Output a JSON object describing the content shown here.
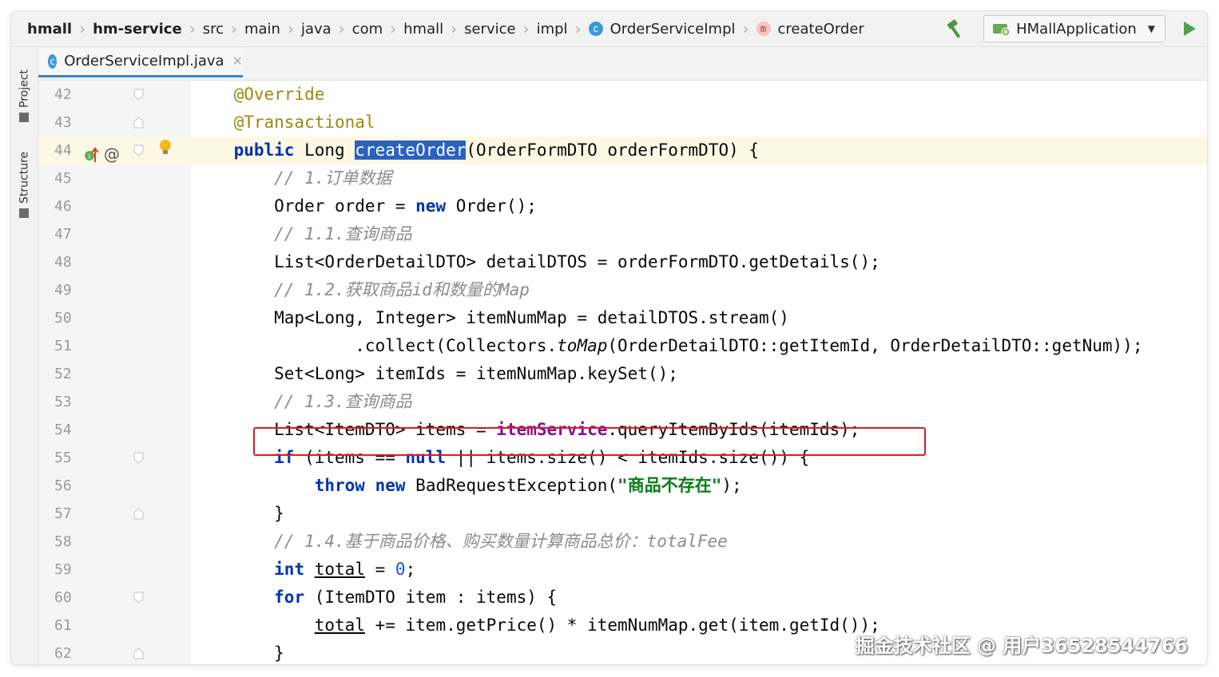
{
  "breadcrumbs": [
    {
      "label": "hmall",
      "bold": true,
      "icon": ""
    },
    {
      "label": "hm-service",
      "bold": true,
      "icon": ""
    },
    {
      "label": "src",
      "bold": false,
      "icon": ""
    },
    {
      "label": "main",
      "bold": false,
      "icon": ""
    },
    {
      "label": "java",
      "bold": false,
      "icon": ""
    },
    {
      "label": "com",
      "bold": false,
      "icon": ""
    },
    {
      "label": "hmall",
      "bold": false,
      "icon": ""
    },
    {
      "label": "service",
      "bold": false,
      "icon": ""
    },
    {
      "label": "impl",
      "bold": false,
      "icon": ""
    },
    {
      "label": "OrderServiceImpl",
      "bold": false,
      "icon": "class-icon",
      "icon_letter": "c"
    },
    {
      "label": "createOrder",
      "bold": false,
      "icon": "method-icon",
      "icon_letter": "m"
    }
  ],
  "toolbar": {
    "build_icon": "hammer-icon",
    "run_config_label": "HMallApplication",
    "run_icon": "run-icon"
  },
  "left_tools": {
    "project_label": "Project",
    "structure_label": "Structure"
  },
  "tabs": [
    {
      "label": "OrderServiceImpl.java",
      "icon_letter": "c",
      "active": true
    }
  ],
  "editor": {
    "current_line": 44,
    "highlighted_line": 54,
    "lines": [
      {
        "n": "42",
        "tokens": [
          [
            "    ",
            ""
          ],
          [
            "@Override",
            "ann"
          ]
        ]
      },
      {
        "n": "43",
        "tokens": [
          [
            "    ",
            ""
          ],
          [
            "@Transactional",
            "ann"
          ]
        ]
      },
      {
        "n": "44",
        "tokens": [
          [
            "    ",
            ""
          ],
          [
            "public",
            "kw"
          ],
          [
            " Long ",
            ""
          ],
          [
            "createOrder",
            "sel"
          ],
          [
            "(OrderFormDTO orderFormDTO) {",
            ""
          ]
        ]
      },
      {
        "n": "45",
        "tokens": [
          [
            "        ",
            ""
          ],
          [
            "// 1.订单数据",
            "cmt"
          ]
        ]
      },
      {
        "n": "46",
        "tokens": [
          [
            "        Order order = ",
            ""
          ],
          [
            "new",
            "kw"
          ],
          [
            " Order();",
            ""
          ]
        ]
      },
      {
        "n": "47",
        "tokens": [
          [
            "        ",
            ""
          ],
          [
            "// 1.1.查询商品",
            "cmt"
          ]
        ]
      },
      {
        "n": "48",
        "tokens": [
          [
            "        List<OrderDetailDTO> detailDTOS = orderFormDTO.getDetails();",
            ""
          ]
        ]
      },
      {
        "n": "49",
        "tokens": [
          [
            "        ",
            ""
          ],
          [
            "// 1.2.获取商品id和数量的Map",
            "cmt"
          ]
        ]
      },
      {
        "n": "50",
        "tokens": [
          [
            "        Map<Long, Integer> itemNumMap = detailDTOS.stream()",
            ""
          ]
        ]
      },
      {
        "n": "51",
        "tokens": [
          [
            "                .collect(Collectors.",
            ""
          ],
          [
            "toMap",
            "static"
          ],
          [
            "(OrderDetailDTO::getItemId, OrderDetailDTO::getNum));",
            ""
          ]
        ]
      },
      {
        "n": "52",
        "tokens": [
          [
            "        Set<Long> itemIds = itemNumMap.keySet();",
            ""
          ]
        ]
      },
      {
        "n": "53",
        "tokens": [
          [
            "        ",
            ""
          ],
          [
            "// 1.3.查询商品",
            "cmt"
          ]
        ]
      },
      {
        "n": "54",
        "tokens": [
          [
            "        List<ItemDTO> items = ",
            ""
          ],
          [
            "itemService",
            "field"
          ],
          [
            ".queryItemByIds(itemIds);",
            ""
          ]
        ]
      },
      {
        "n": "55",
        "tokens": [
          [
            "        ",
            ""
          ],
          [
            "if",
            "kw"
          ],
          [
            " (items == ",
            ""
          ],
          [
            "null",
            "kw"
          ],
          [
            " || items.size() < itemIds.size()) {",
            ""
          ]
        ]
      },
      {
        "n": "56",
        "tokens": [
          [
            "            ",
            ""
          ],
          [
            "throw",
            "kw"
          ],
          [
            " ",
            ""
          ],
          [
            "new",
            "kw"
          ],
          [
            " BadRequestException(",
            ""
          ],
          [
            "\"商品不存在\"",
            "str"
          ],
          [
            ");",
            ""
          ]
        ]
      },
      {
        "n": "57",
        "tokens": [
          [
            "        }",
            ""
          ]
        ]
      },
      {
        "n": "58",
        "tokens": [
          [
            "        ",
            ""
          ],
          [
            "// 1.4.基于商品价格、购买数量计算商品总价：totalFee",
            "cmt"
          ]
        ]
      },
      {
        "n": "59",
        "tokens": [
          [
            "        ",
            ""
          ],
          [
            "int",
            "kw"
          ],
          [
            " ",
            ""
          ],
          [
            "total",
            "ul"
          ],
          [
            " = ",
            ""
          ],
          [
            "0",
            "num"
          ],
          [
            ";",
            ""
          ]
        ]
      },
      {
        "n": "60",
        "tokens": [
          [
            "        ",
            ""
          ],
          [
            "for",
            "kw"
          ],
          [
            " (ItemDTO item : items) {",
            ""
          ]
        ]
      },
      {
        "n": "61",
        "tokens": [
          [
            "            ",
            ""
          ],
          [
            "total",
            "ul"
          ],
          [
            " += item.getPrice() * itemNumMap.get(item.getId());",
            ""
          ]
        ]
      },
      {
        "n": "62",
        "tokens": [
          [
            "        }",
            ""
          ]
        ]
      }
    ]
  },
  "watermark": "掘金技术社区 @ 用户36528544766",
  "colors": {
    "keyword": "#0033b3",
    "annotation": "#9e880d",
    "comment": "#8c8c8c",
    "string": "#067d17",
    "field": "#871094",
    "selection": "#2a62c0",
    "highlight_box": "#d81e1e",
    "current_line_bg": "#fcf8e3"
  }
}
